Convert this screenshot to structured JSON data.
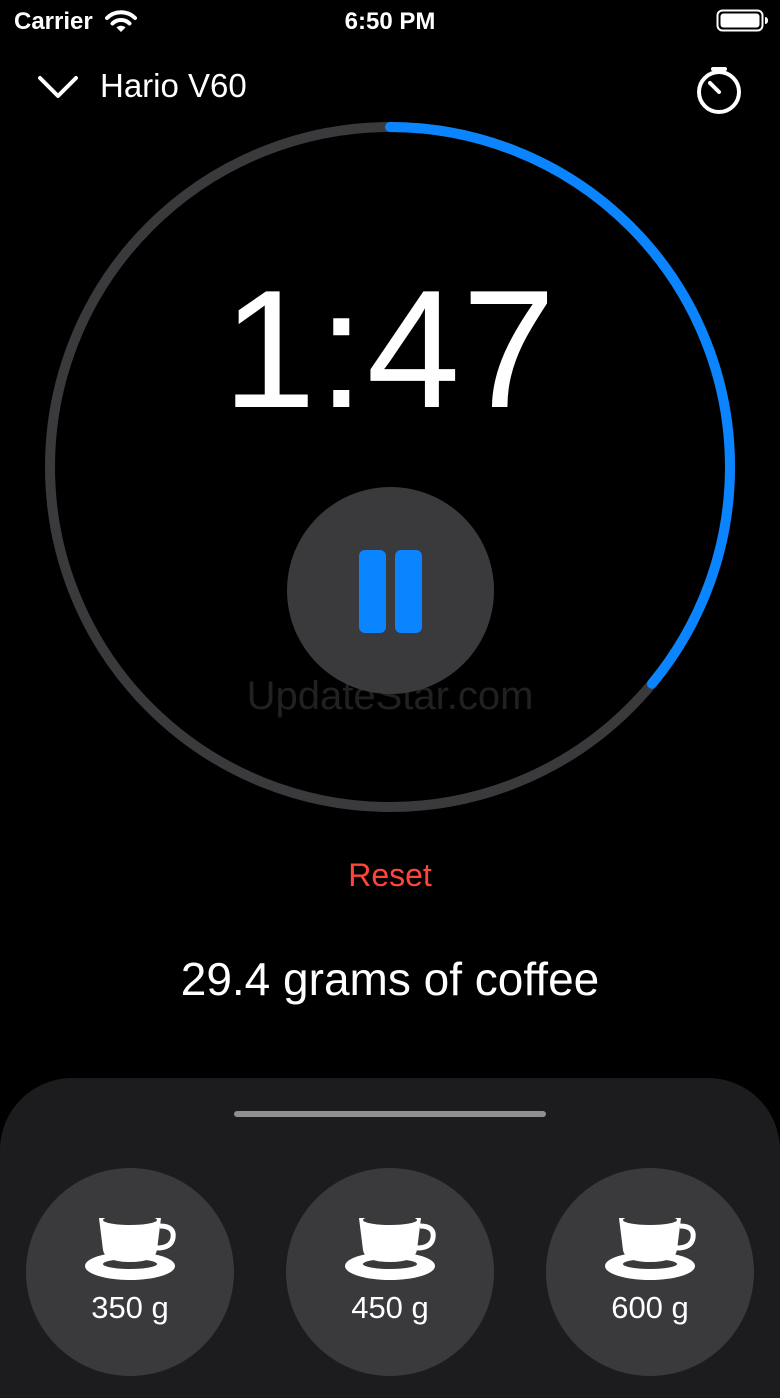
{
  "status_bar": {
    "carrier": "Carrier",
    "time": "6:50 PM"
  },
  "header": {
    "title": "Hario V60"
  },
  "timer": {
    "display": "1:47",
    "progress": 0.36
  },
  "colors": {
    "accent": "#0a84ff",
    "reset": "#ff453a",
    "ring_track": "#3a3a3c",
    "sheet": "#1c1c1e"
  },
  "actions": {
    "reset_label": "Reset"
  },
  "coffee": {
    "amount_text": "29.4 grams of coffee"
  },
  "watermark": "UpdateStar.com",
  "sizes": [
    {
      "label": "350 g",
      "icon": "coffee-cup-icon"
    },
    {
      "label": "450 g",
      "icon": "coffee-cup-icon"
    },
    {
      "label": "600 g",
      "icon": "coffee-cup-icon"
    }
  ]
}
